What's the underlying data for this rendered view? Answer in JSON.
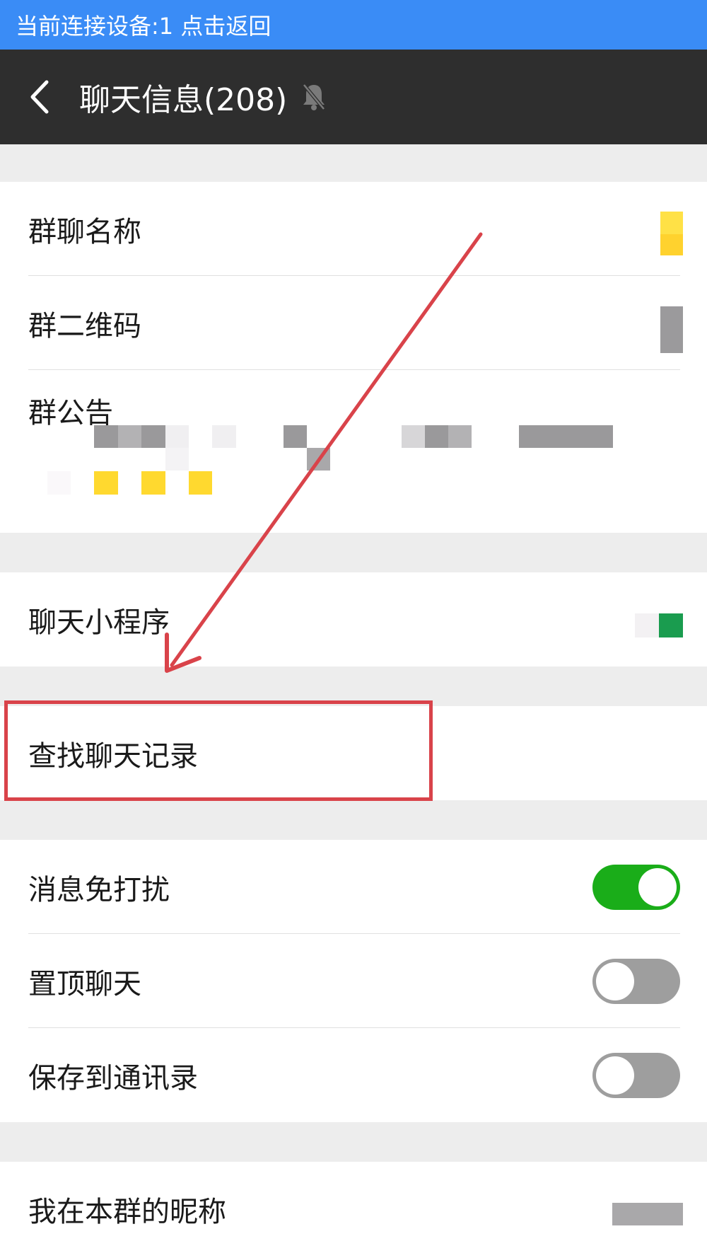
{
  "status_bar": {
    "text": "当前连接设备:1  点击返回"
  },
  "header": {
    "title": "聊天信息(208)"
  },
  "group_section": {
    "name_label": "群聊名称",
    "qrcode_label": "群二维码",
    "notice_label": "群公告"
  },
  "mini_program": {
    "label": "聊天小程序"
  },
  "search_history": {
    "label": "查找聊天记录"
  },
  "settings": {
    "mute_label": "消息免打扰",
    "mute_on": true,
    "sticky_label": "置顶聊天",
    "sticky_on": false,
    "save_label": "保存到通讯录",
    "save_on": false
  },
  "nickname": {
    "label": "我在本群的昵称"
  },
  "colors": {
    "status_bar": "#3a8cf6",
    "header_bg": "#2e2e2e",
    "toggle_on": "#1aad19",
    "toggle_off": "#9e9e9e",
    "annotation_red": "#d9434a"
  },
  "icons": {
    "back": "chevron-left-icon",
    "mute": "bell-off-icon"
  }
}
